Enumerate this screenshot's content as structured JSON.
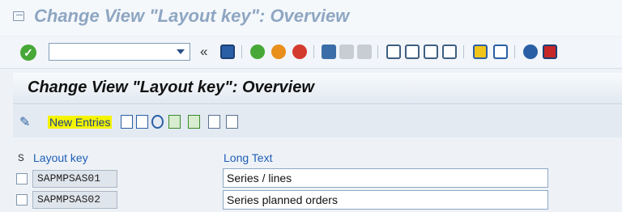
{
  "window": {
    "title": "Change View \"Layout key\": Overview",
    "icon": "window-icon"
  },
  "toolbar": {
    "command_field": {
      "value": "",
      "placeholder": ""
    },
    "back_glyph": "«",
    "colors": {
      "green": "#47a838",
      "orange": "#e8901b",
      "red": "#d43b2f",
      "blue": "#2a5fa6",
      "yellow": "#f0c419"
    }
  },
  "panel": {
    "title": "Change View \"Layout key\": Overview"
  },
  "actions": {
    "new_entries": "New Entries"
  },
  "table": {
    "columns": {
      "select": "S",
      "layout_key": "Layout key",
      "long_text": "Long Text"
    },
    "rows": [
      {
        "key": "SAPMPSAS01",
        "text": "Series / lines"
      },
      {
        "key": "SAPMPSAS02",
        "text": "Series planned orders"
      }
    ]
  }
}
